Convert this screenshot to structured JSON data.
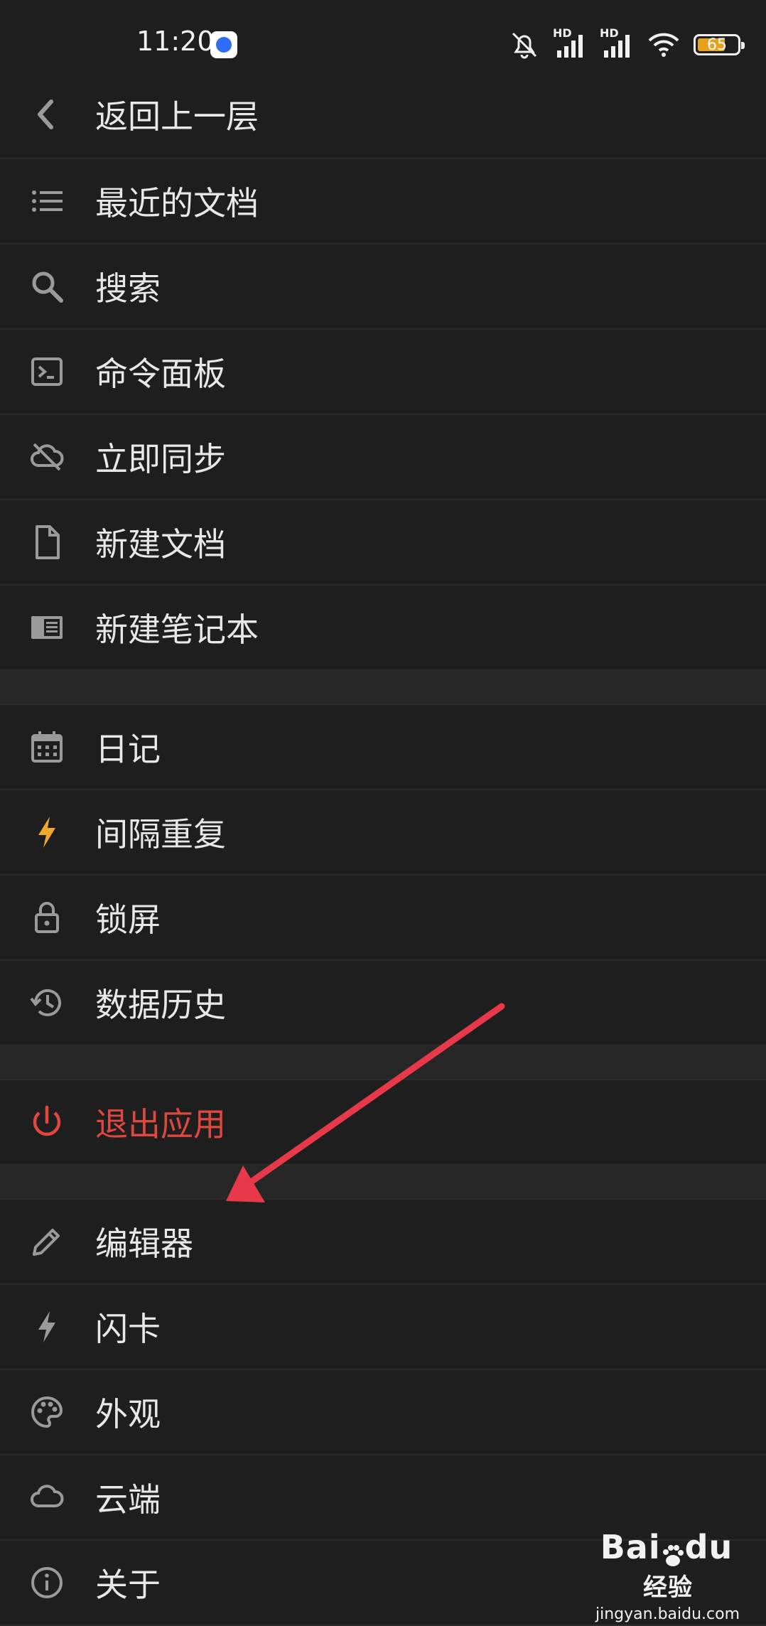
{
  "status_bar": {
    "time": "11:20",
    "battery_level": "65",
    "signal_labels": [
      "HD",
      "HD"
    ]
  },
  "menu": {
    "back": {
      "label": "返回上一层",
      "icon": "chevron-left-icon"
    },
    "group1": [
      {
        "label": "最近的文档",
        "icon": "list-icon"
      },
      {
        "label": "搜索",
        "icon": "search-icon"
      },
      {
        "label": "命令面板",
        "icon": "terminal-icon"
      },
      {
        "label": "立即同步",
        "icon": "cloud-off-icon"
      },
      {
        "label": "新建文档",
        "icon": "file-icon"
      },
      {
        "label": "新建笔记本",
        "icon": "notebook-icon"
      }
    ],
    "group2": [
      {
        "label": "日记",
        "icon": "calendar-icon"
      },
      {
        "label": "间隔重复",
        "icon": "lightning-icon",
        "color": "#f0a72a"
      },
      {
        "label": "锁屏",
        "icon": "lock-icon"
      },
      {
        "label": "数据历史",
        "icon": "history-icon"
      }
    ],
    "exit": {
      "label": "退出应用",
      "icon": "power-icon",
      "color": "#e0473e"
    },
    "group3": [
      {
        "label": "编辑器",
        "icon": "pencil-icon"
      },
      {
        "label": "闪卡",
        "icon": "lightning-icon"
      },
      {
        "label": "外观",
        "icon": "palette-icon"
      },
      {
        "label": "云端",
        "icon": "cloud-icon"
      },
      {
        "label": "关于",
        "icon": "info-icon"
      }
    ]
  },
  "annotation": {
    "arrow_color": "#e8394a"
  },
  "watermark": {
    "brand_left": "Bai",
    "brand_right": "du",
    "brand_suffix": "经验",
    "domain": "jingyan.baidu.com"
  }
}
